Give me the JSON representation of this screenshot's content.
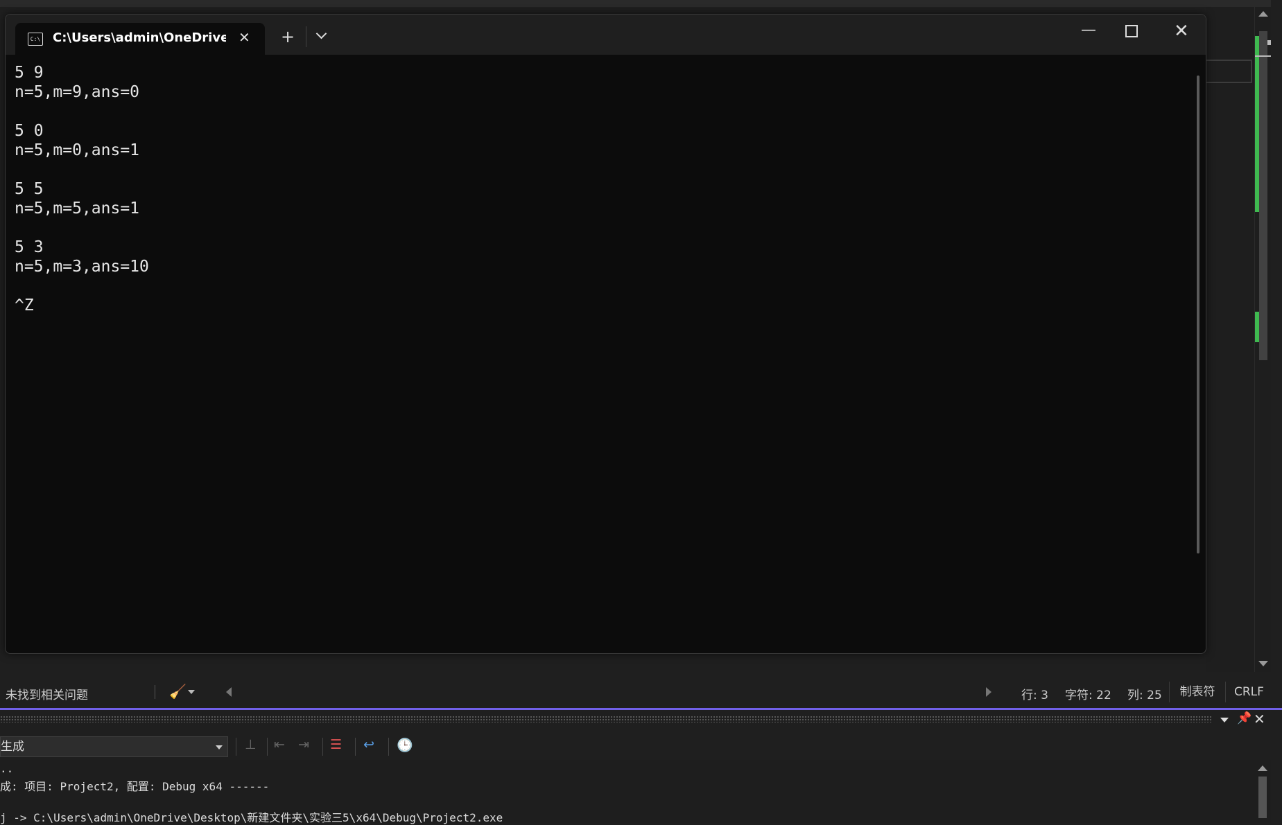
{
  "terminal": {
    "tab_title": "C:\\Users\\admin\\OneDrive\\Des",
    "icon": "cmd-icon",
    "new_tab": "+",
    "console_lines": [
      "5 9",
      "n=5,m=9,ans=0",
      "",
      "5 0",
      "n=5,m=0,ans=1",
      "",
      "5 5",
      "n=5,m=5,ans=1",
      "",
      "5 3",
      "n=5,m=3,ans=10",
      "",
      "^Z"
    ]
  },
  "statusbar": {
    "issues": "未找到相关问题",
    "line": "行: 3",
    "char": "字符: 22",
    "col": "列: 25",
    "indent": "制表符",
    "eol": "CRLF"
  },
  "output_panel": {
    "source_selector": "生成",
    "lines": [
      "..",
      "成: 项目: Project2, 配置: Debug x64 ------",
      "j -> C:\\Users\\admin\\OneDrive\\Desktop\\新建文件夹\\实验三5\\x64\\Debug\\Project2.exe"
    ]
  },
  "colors": {
    "panel_accent": "#7160e8",
    "change_marker": "#3fb950",
    "terminal_bg": "#0c0c0c"
  }
}
